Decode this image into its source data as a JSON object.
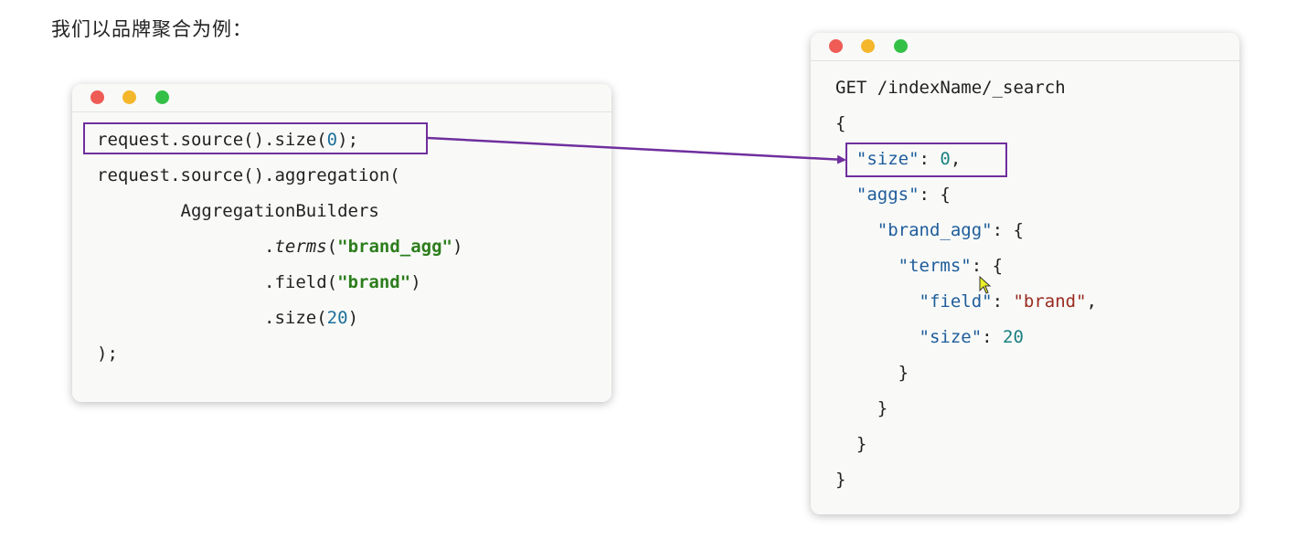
{
  "heading": "我们以品牌聚合为例：",
  "java_window": {
    "lines": [
      {
        "parts": [
          {
            "t": "request.source().size("
          },
          {
            "t": "0",
            "c": "num"
          },
          {
            "t": ");"
          }
        ]
      },
      {
        "parts": [
          {
            "t": "request.source().aggregation("
          }
        ]
      },
      {
        "parts": [
          {
            "t": "        AggregationBuilders"
          }
        ]
      },
      {
        "parts": [
          {
            "t": "                ."
          },
          {
            "t": "terms",
            "c": "ital"
          },
          {
            "t": "("
          },
          {
            "t": "\"brand_agg\"",
            "c": "kw-green"
          },
          {
            "t": ")"
          }
        ]
      },
      {
        "parts": [
          {
            "t": "                .field("
          },
          {
            "t": "\"brand\"",
            "c": "kw-green"
          },
          {
            "t": ")"
          }
        ]
      },
      {
        "parts": [
          {
            "t": "                .size("
          },
          {
            "t": "20",
            "c": "num"
          },
          {
            "t": ")"
          }
        ]
      },
      {
        "parts": [
          {
            "t": ");"
          }
        ]
      }
    ]
  },
  "dsl_window": {
    "lines": [
      {
        "parts": [
          {
            "t": "GET /indexName/_search"
          }
        ]
      },
      {
        "parts": [
          {
            "t": "{"
          }
        ]
      },
      {
        "parts": [
          {
            "t": "  "
          },
          {
            "t": "\"size\"",
            "c": "key"
          },
          {
            "t": ": "
          },
          {
            "t": "0",
            "c": "numv"
          },
          {
            "t": ","
          }
        ]
      },
      {
        "parts": [
          {
            "t": "  "
          },
          {
            "t": "\"aggs\"",
            "c": "key"
          },
          {
            "t": ": {"
          }
        ]
      },
      {
        "parts": [
          {
            "t": "    "
          },
          {
            "t": "\"brand_agg\"",
            "c": "key"
          },
          {
            "t": ": {"
          }
        ]
      },
      {
        "parts": [
          {
            "t": "      "
          },
          {
            "t": "\"terms\"",
            "c": "key"
          },
          {
            "t": ": {"
          }
        ]
      },
      {
        "parts": [
          {
            "t": "        "
          },
          {
            "t": "\"field\"",
            "c": "key"
          },
          {
            "t": ": "
          },
          {
            "t": "\"brand\"",
            "c": "str"
          },
          {
            "t": ","
          }
        ]
      },
      {
        "parts": [
          {
            "t": "        "
          },
          {
            "t": "\"size\"",
            "c": "key"
          },
          {
            "t": ": "
          },
          {
            "t": "20",
            "c": "numv"
          }
        ]
      },
      {
        "parts": [
          {
            "t": "      }"
          }
        ]
      },
      {
        "parts": [
          {
            "t": "    }"
          }
        ]
      },
      {
        "parts": [
          {
            "t": "  }"
          }
        ]
      },
      {
        "parts": [
          {
            "t": "}"
          }
        ]
      }
    ]
  },
  "colors": {
    "highlight": "#6f2f9e",
    "red_dot": "#ef5b55",
    "yellow_dot": "#f4b72c",
    "green_dot": "#34c047"
  },
  "icons": [
    "close-dot-icon",
    "minimize-dot-icon",
    "maximize-dot-icon",
    "mouse-cursor-icon",
    "connector-arrow-icon"
  ]
}
